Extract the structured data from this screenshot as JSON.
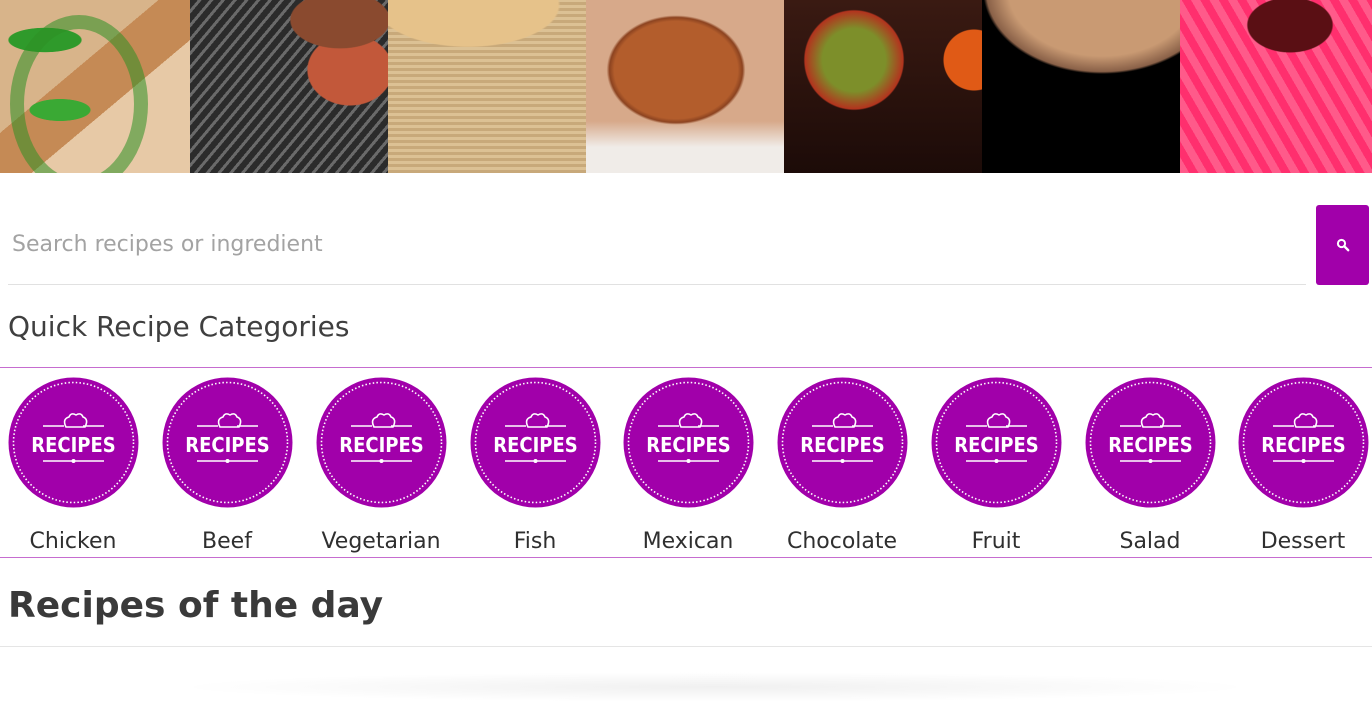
{
  "banner": {
    "images": [
      {
        "label": "green-peppers"
      },
      {
        "label": "grilled-meat"
      },
      {
        "label": "bread-loaves"
      },
      {
        "label": "fried-food"
      },
      {
        "label": "tomatoes"
      },
      {
        "label": "baked-bread"
      },
      {
        "label": "pink-donut"
      }
    ]
  },
  "search": {
    "placeholder": "Search recipes or ingredient",
    "value": "",
    "button_icon": "search-icon"
  },
  "categories": {
    "title": "Quick Recipe Categories",
    "badge_text": "RECIPES",
    "items": [
      {
        "label": "Chicken"
      },
      {
        "label": "Beef"
      },
      {
        "label": "Vegetarian"
      },
      {
        "label": "Fish"
      },
      {
        "label": "Mexican"
      },
      {
        "label": "Chocolate"
      },
      {
        "label": "Fruit"
      },
      {
        "label": "Salad"
      },
      {
        "label": "Dessert"
      }
    ]
  },
  "recipes_of_day": {
    "title": "Recipes of the day"
  },
  "colors": {
    "accent": "#a100aa",
    "divider": "#c66cd0"
  }
}
